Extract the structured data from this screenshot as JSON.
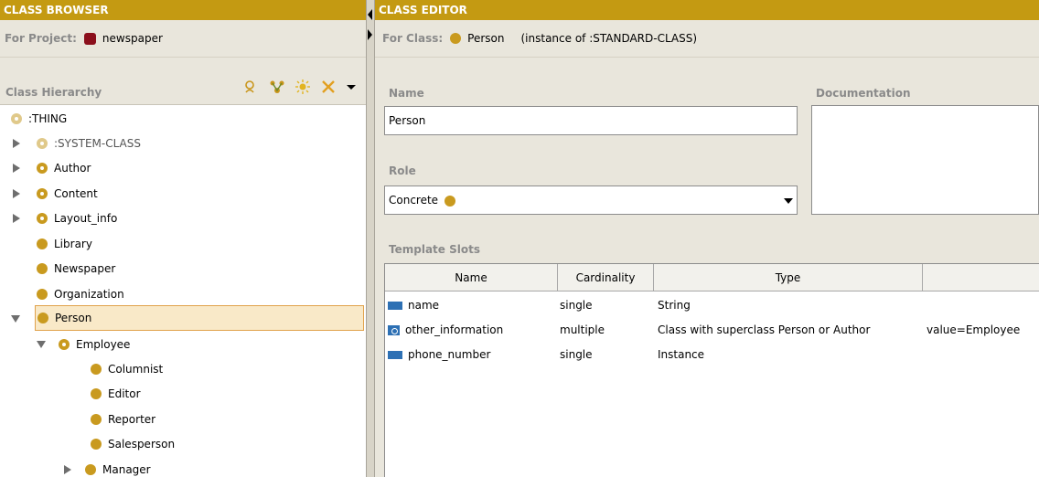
{
  "browser": {
    "title": "CLASS BROWSER",
    "project_label": "For Project:",
    "project_name": "newspaper",
    "hierarchy_label": "Class Hierarchy",
    "tools": [
      "find-icon",
      "add-subclass-icon",
      "add-superclass-icon",
      "delete-class-icon",
      "menu-arrow-icon"
    ],
    "tree": [
      {
        "label": ":THING"
      },
      {
        "label": ":SYSTEM-CLASS"
      },
      {
        "label": "Author"
      },
      {
        "label": "Content"
      },
      {
        "label": "Layout_info"
      },
      {
        "label": "Library"
      },
      {
        "label": "Newspaper"
      },
      {
        "label": "Organization"
      },
      {
        "label": "Person"
      },
      {
        "label": "Employee"
      },
      {
        "label": "Columnist"
      },
      {
        "label": "Editor"
      },
      {
        "label": "Reporter"
      },
      {
        "label": "Salesperson"
      },
      {
        "label": "Manager"
      }
    ]
  },
  "editor": {
    "title": "CLASS EDITOR",
    "class_label": "For Class:",
    "class_name": "Person",
    "instance_of": "(instance of :STANDARD-CLASS)",
    "name_label": "Name",
    "name_value": "Person",
    "documentation_label": "Documentation",
    "role_label": "Role",
    "role_value": "Concrete",
    "slots_label": "Template Slots",
    "columns": [
      "Name",
      "Cardinality",
      "Type",
      ""
    ],
    "slots": [
      {
        "name": "name",
        "cardinality": "single",
        "type": "String",
        "other": ""
      },
      {
        "name": "other_information",
        "cardinality": "multiple",
        "type": "Class with superclass Person or Author",
        "other": "value=Employee"
      },
      {
        "name": "phone_number",
        "cardinality": "single",
        "type": "Instance",
        "other": ""
      }
    ]
  },
  "colors": {
    "title_bar": "#c49a12",
    "panel_bg": "#e9e6dc",
    "class_dot": "#c99a1f",
    "project_icon": "#8b0f1c",
    "selection": "#f9e9c8",
    "slot_icon": "#2d70b4"
  }
}
